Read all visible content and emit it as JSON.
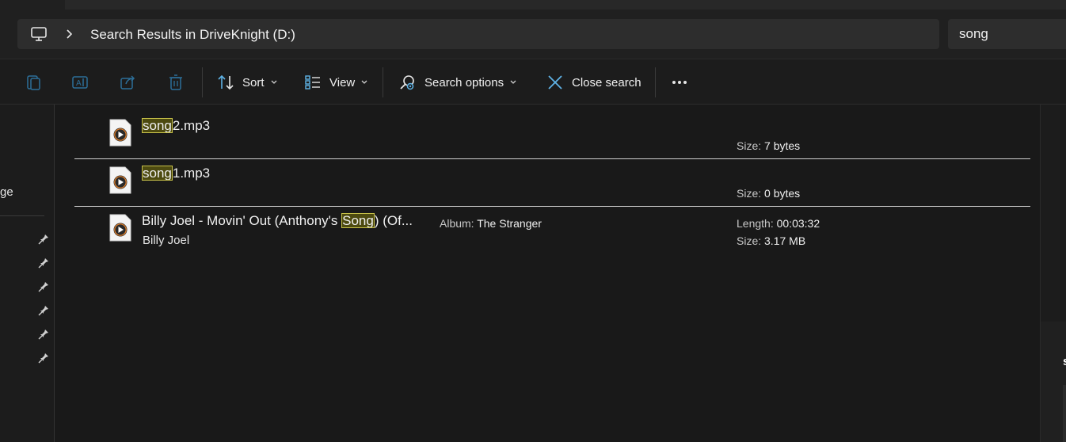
{
  "address": {
    "path": "Search Results in DriveKnight (D:)",
    "search_value": "song",
    "search_placeholder": "Search"
  },
  "toolbar": {
    "sort_label": "Sort",
    "view_label": "View",
    "search_options_label": "Search options",
    "close_search_label": "Close search"
  },
  "nav": {
    "partial_label": "ge"
  },
  "results": [
    {
      "highlight": "song",
      "rest": "2.mp3",
      "size_label": "Size: ",
      "size_value": "7 bytes"
    },
    {
      "highlight": "song",
      "rest": "1.mp3",
      "size_label": "Size: ",
      "size_value": "0 bytes"
    },
    {
      "prefix": "Billy Joel - Movin' Out (Anthony's ",
      "highlight": "Song",
      "rest": ") (Of...",
      "artist": "Billy Joel",
      "album_label": "Album: ",
      "album_value": "The Stranger",
      "length_label": "Length: ",
      "length_value": "00:03:32",
      "size_label": "Size: ",
      "size_value": "3.17 MB"
    }
  ],
  "details": {
    "partial_text": "s"
  },
  "colors": {
    "highlight_bg": "#4d4a10",
    "highlight_border": "#c8c24a",
    "icon_accent": "#5fb3e6"
  }
}
